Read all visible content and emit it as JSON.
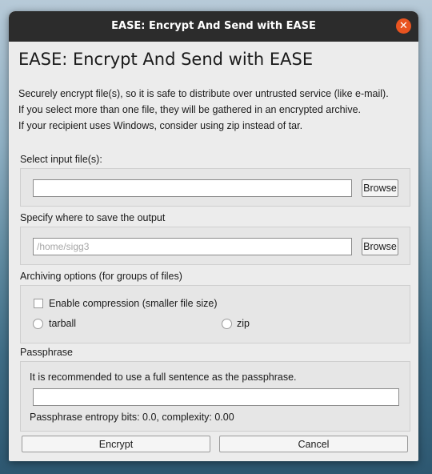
{
  "window": {
    "title": "EASE: Encrypt And Send with EASE",
    "close_label": "✕"
  },
  "header": {
    "heading": "EASE: Encrypt And Send with EASE",
    "description": [
      "Securely encrypt file(s), so it is safe to distribute over untrusted service (like e-mail).",
      "If you select more than one file, they will be gathered in an encrypted archive.",
      "If your recipient uses Windows, consider using zip instead of tar."
    ]
  },
  "input_files": {
    "label": "Select input file(s):",
    "value": "",
    "placeholder": "",
    "browse_label": "Browse"
  },
  "output": {
    "label": "Specify where to save the output",
    "value": "",
    "placeholder": "/home/sigg3",
    "browse_label": "Browse"
  },
  "archiving": {
    "label": "Archiving options (for groups of files)",
    "compression_label": "Enable compression (smaller file size)",
    "compression_checked": false,
    "tarball_label": "tarball",
    "zip_label": "zip"
  },
  "passphrase": {
    "label": "Passphrase",
    "hint": "It is recommended to use a full sentence as the passphrase.",
    "value": "",
    "entropy_text": "Passphrase entropy bits: 0.0, complexity: 0.00"
  },
  "actions": {
    "encrypt_label": "Encrypt",
    "cancel_label": "Cancel"
  }
}
